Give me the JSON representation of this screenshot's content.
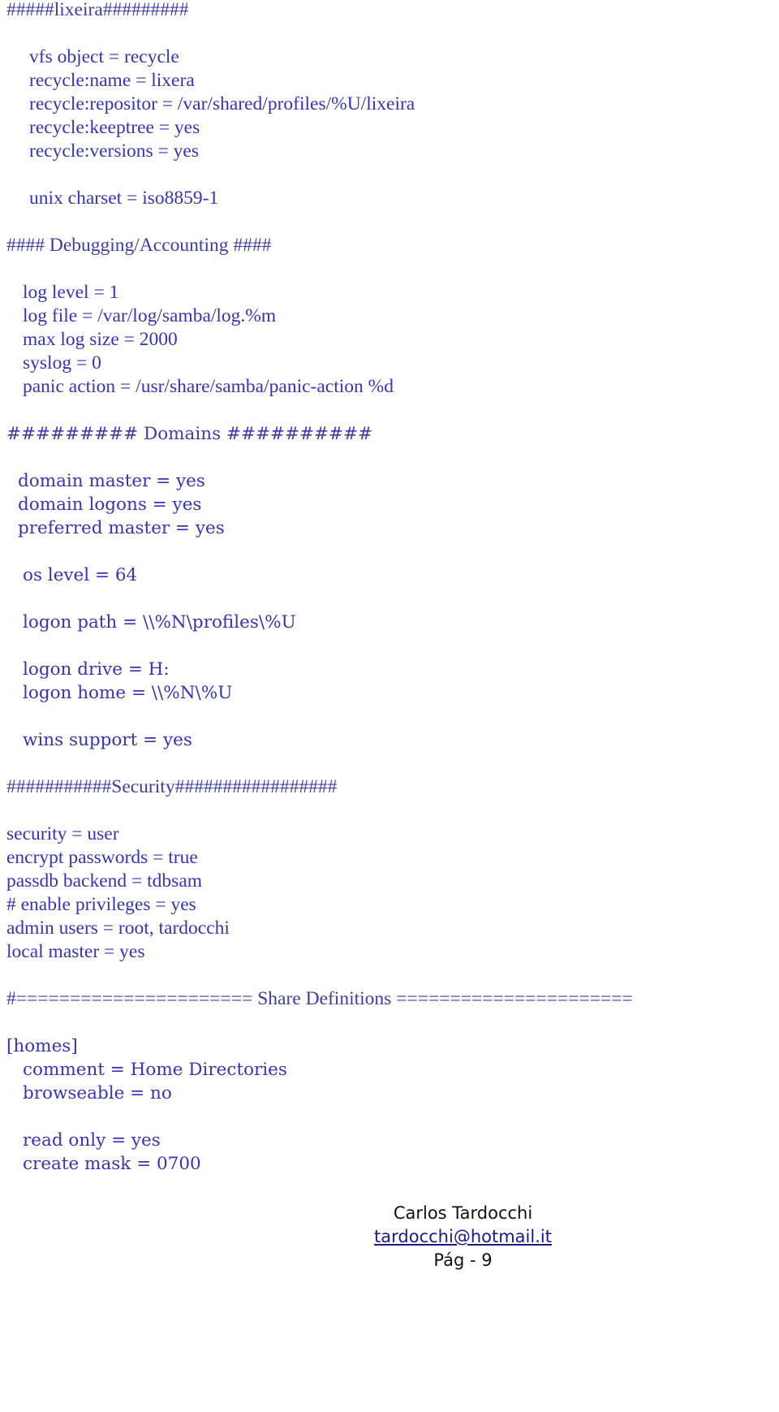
{
  "document": {
    "lines": [
      {
        "text": "#####lixeira#########",
        "indent": 0,
        "row": 0,
        "kind": "header"
      },
      {
        "text": "vfs object = recycle",
        "indent": 28,
        "row": 2
      },
      {
        "text": "recycle:name = lixera",
        "indent": 28,
        "row": 3
      },
      {
        "text": "recycle:repositor = /var/shared/profiles/%U/lixeira",
        "indent": 28,
        "row": 4
      },
      {
        "text": "recycle:keeptree = yes",
        "indent": 28,
        "row": 5
      },
      {
        "text": "recycle:versions = yes",
        "indent": 28,
        "row": 6
      },
      {
        "text": "unix charset = iso8859-1",
        "indent": 28,
        "row": 8
      },
      {
        "text": "#### Debugging/Accounting ####",
        "indent": 0,
        "row": 10,
        "kind": "header"
      },
      {
        "text": "log level = 1",
        "indent": 20,
        "row": 12
      },
      {
        "text": "log file = /var/log/samba/log.%m",
        "indent": 20,
        "row": 13
      },
      {
        "text": "max log size = 2000",
        "indent": 20,
        "row": 14
      },
      {
        "text": "syslog = 0",
        "indent": 20,
        "row": 15
      },
      {
        "text": "panic action = /usr/share/samba/panic-action %d",
        "indent": 20,
        "row": 16
      },
      {
        "text": "######### Domains ##########",
        "indent": 0,
        "row": 18,
        "kind": "header",
        "wide": true
      },
      {
        "text": "domain master = yes",
        "indent": 14,
        "row": 20,
        "wide": true
      },
      {
        "text": "domain logons = yes",
        "indent": 14,
        "row": 21,
        "wide": true
      },
      {
        "text": "preferred master = yes",
        "indent": 14,
        "row": 22,
        "wide": true
      },
      {
        "text": "os level = 64",
        "indent": 20,
        "row": 24,
        "wide": true
      },
      {
        "text": "logon path = \\\\%N\\profiles\\%U",
        "indent": 20,
        "row": 26,
        "wide": true
      },
      {
        "text": "logon drive = H:",
        "indent": 20,
        "row": 28,
        "wide": true
      },
      {
        "text": "logon home = \\\\%N\\%U",
        "indent": 20,
        "row": 29,
        "wide": true
      },
      {
        "text": "wins support = yes",
        "indent": 20,
        "row": 31,
        "wide": true
      },
      {
        "text": "###########Security#################",
        "indent": 0,
        "row": 33,
        "kind": "header"
      },
      {
        "text": "security = user",
        "indent": 0,
        "row": 35
      },
      {
        "text": "encrypt passwords = true",
        "indent": 0,
        "row": 36
      },
      {
        "text": "passdb backend = tdbsam",
        "indent": 0,
        "row": 37
      },
      {
        "text": "# enable privileges = yes",
        "indent": 0,
        "row": 38
      },
      {
        "text": "admin users = root, tardocchi",
        "indent": 0,
        "row": 39
      },
      {
        "text": "local master = yes",
        "indent": 0,
        "row": 40
      },
      {
        "text": "#====================== Share Definitions ======================",
        "indent": 0,
        "row": 42,
        "kind": "header"
      },
      {
        "text": "[homes]",
        "indent": 0,
        "row": 44,
        "wide": true
      },
      {
        "text": "comment = Home Directories",
        "indent": 20,
        "row": 45,
        "wide": true
      },
      {
        "text": "browseable = no",
        "indent": 20,
        "row": 46,
        "wide": true
      },
      {
        "text": "read only = yes",
        "indent": 20,
        "row": 48,
        "wide": true
      },
      {
        "text": "create mask = 0700",
        "indent": 20,
        "row": 49,
        "wide": true
      }
    ]
  },
  "footer": {
    "author": "Carlos Tardocchi",
    "email": "tardocchi@hotmail.it",
    "page": "Pág - 9"
  },
  "colors": {
    "text": "#3535b5",
    "footer_text": "#111111",
    "link": "#1a1a8a"
  }
}
